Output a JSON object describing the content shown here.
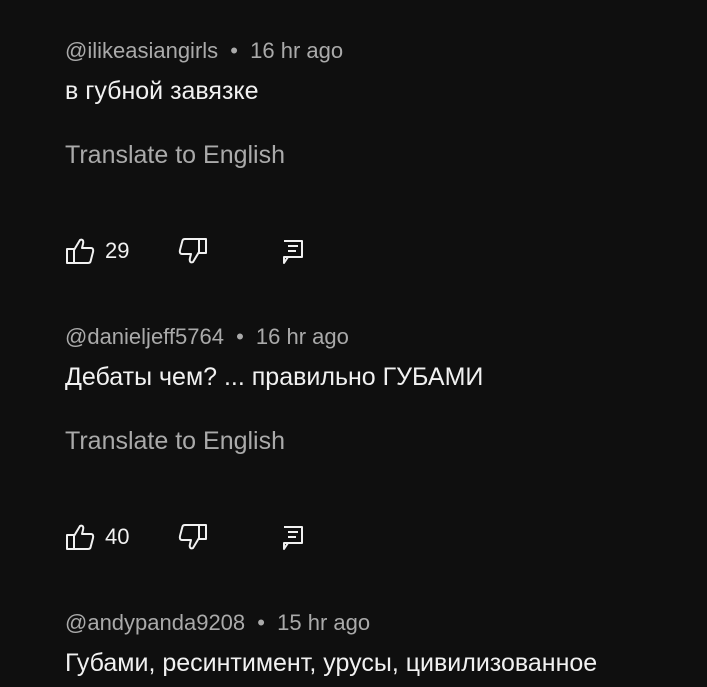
{
  "comments": [
    {
      "author": "@ilikeasiangirls",
      "separator": "•",
      "time": "16 hr ago",
      "text": "в губной завязке",
      "translate": "Translate to English",
      "likes": "29"
    },
    {
      "author": "@danieljeff5764",
      "separator": "•",
      "time": "16 hr ago",
      "text": "Дебаты чем? ... правильно ГУБАМИ",
      "translate": "Translate to English",
      "likes": "40"
    },
    {
      "author": "@andypanda9208",
      "separator": "•",
      "time": "15 hr ago",
      "text": "Губами, ресинтимент, урусы, цивилизованное"
    }
  ],
  "icons": {
    "like": "thumbs-up-icon",
    "dislike": "thumbs-down-icon",
    "reply": "reply-comment-icon"
  },
  "colors": {
    "background": "#0f0f0f",
    "primary_text": "#f1f1f1",
    "secondary_text": "#aaaaaa"
  }
}
